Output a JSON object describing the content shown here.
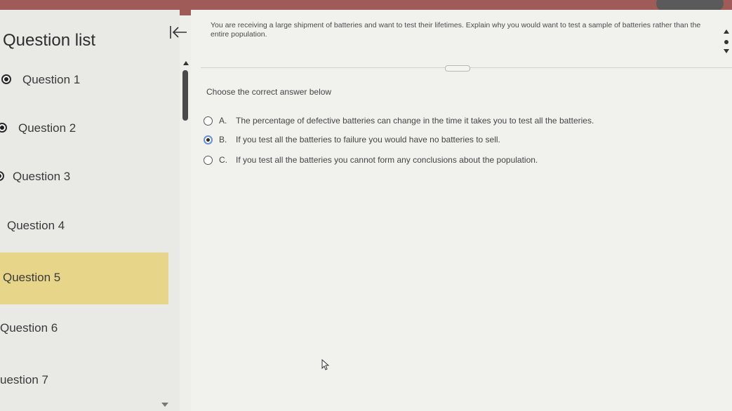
{
  "header": {
    "accent_color": "#9e5b58"
  },
  "sidebar": {
    "title": "Question list",
    "active_color": "#e7d58a",
    "items": [
      {
        "label": "Question 1",
        "answered": true
      },
      {
        "label": "Question 2",
        "answered": true
      },
      {
        "label": "Question 3",
        "answered": true
      },
      {
        "label": "Question 4",
        "answered": false
      },
      {
        "label": "Question 5",
        "answered": false,
        "current": true
      },
      {
        "label": "Question 6",
        "answered": false
      },
      {
        "label": "uestion 7",
        "answered": false
      }
    ]
  },
  "question": {
    "prompt": "You are receiving a large shipment of batteries and want to test their lifetimes. Explain why you would want to test a sample of batteries rather than the entire population.",
    "instruction": "Choose the correct answer below",
    "options": [
      {
        "letter": "A.",
        "text": "The percentage of defective batteries can change in the time it takes you to test all the batteries."
      },
      {
        "letter": "B.",
        "text": "If you test all the batteries to failure you would have no batteries to sell."
      },
      {
        "letter": "C.",
        "text": "If you test all the batteries you cannot form any conclusions about the population."
      }
    ],
    "selected": "B."
  },
  "icons": {
    "collapse": "collapse-left-icon",
    "cursor": "mouse-pointer-icon"
  }
}
